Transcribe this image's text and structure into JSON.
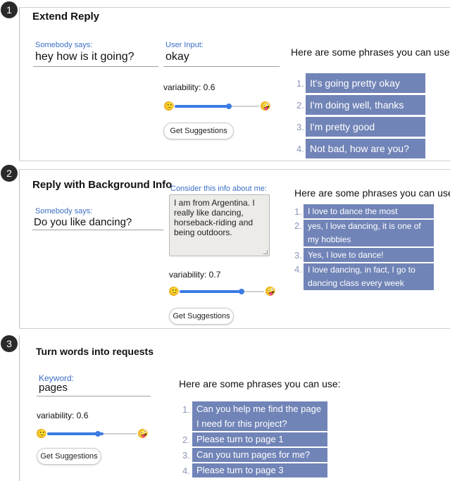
{
  "sections": [
    {
      "number": "1",
      "title": "Extend Reply",
      "somebody_label": "Somebody says:",
      "somebody_value": "hey how is it going?",
      "input_label": "User Input:",
      "input_value": "okay",
      "variability_label": "variability: 0.6",
      "variability": 0.6,
      "button": "Get Suggestions",
      "phrases_header": "Here are some phrases you can use:",
      "phrases": [
        {
          "n": "1.",
          "text": "It's going pretty okay"
        },
        {
          "n": "2.",
          "text": "I'm doing well, thanks"
        },
        {
          "n": "3.",
          "text": "I'm pretty good"
        },
        {
          "n": "4.",
          "text": "Not bad, how are you?"
        }
      ]
    },
    {
      "number": "2",
      "title": "Reply with Background Info",
      "somebody_label": "Somebody says:",
      "somebody_value": "Do you like dancing?",
      "info_label": "Consider this info about me:",
      "info_value": "I am from Argentina. I really like dancing, horseback-riding and being outdoors.",
      "variability_label": "variability: 0.7",
      "variability": 0.7,
      "button": "Get Suggestions",
      "phrases_header": "Here are some phrases you can use:",
      "phrases": [
        {
          "n": "1.",
          "line1": "I love to dance the most",
          "line2": ""
        },
        {
          "n": "2.",
          "line1": "yes, I love dancing, it is one of",
          "line2": "my hobbies"
        },
        {
          "n": "3.",
          "line1": "Yes, I love to dance!",
          "line2": ""
        },
        {
          "n": "4.",
          "line1": "I love dancing, in fact, I go to",
          "line2": "dancing class every week"
        }
      ]
    },
    {
      "number": "3",
      "title": "Turn words into requests",
      "keyword_label": "Keyword:",
      "keyword_value": "pages",
      "variability_label": "variability: 0.6",
      "variability": 0.6,
      "button": "Get Suggestions",
      "phrases_header": "Here are some phrases you can use:",
      "phrases": [
        {
          "n": "1.",
          "line1": "Can you help me find the page",
          "line2": "I need for this project?"
        },
        {
          "n": "2.",
          "line1": "Please turn to page 1",
          "line2": ""
        },
        {
          "n": "3.",
          "line1": "Can you turn pages for me?",
          "line2": ""
        },
        {
          "n": "4.",
          "line1": "Please turn to page 3",
          "line2": ""
        }
      ]
    }
  ],
  "icons": {
    "low": "slightly-smiling-face-icon",
    "high": "zany-face-icon"
  },
  "colors": {
    "pill": "#7184b7",
    "label": "#3b6ec4",
    "slider": "#3b7be3"
  }
}
